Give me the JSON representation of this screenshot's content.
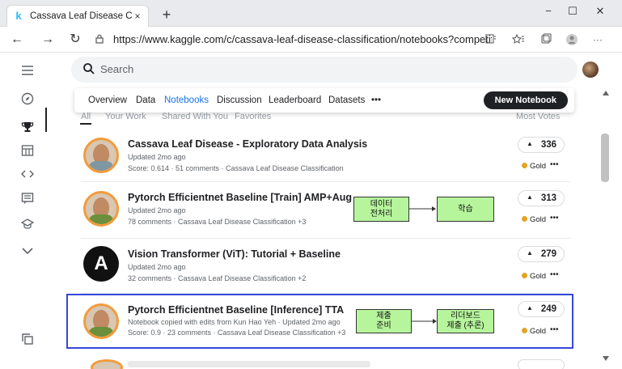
{
  "browser": {
    "tab_title": "Cassava Leaf Disease Classificatio",
    "tab_close": "×",
    "new_tab": "+",
    "url": "https://www.kaggle.com/c/cassava-leaf-disease-classification/notebooks?competitionId...",
    "win_min": "−",
    "win_max": "☐",
    "win_close": "✕",
    "back": "←",
    "forward": "→",
    "refresh": "↻",
    "more": "···"
  },
  "search": {
    "placeholder": "Search"
  },
  "subnav": {
    "items": [
      "Overview",
      "Data",
      "Notebooks",
      "Discussion",
      "Leaderboard",
      "Datasets",
      "•••"
    ],
    "new_notebook": "New Notebook",
    "filters": [
      "All",
      "Your Work",
      "Shared With You",
      "Favorites"
    ],
    "sort": "Most Votes"
  },
  "notebooks": [
    {
      "title": "Cassava Leaf Disease - Exploratory Data Analysis",
      "line1": "Updated 2mo ago",
      "line2": "Score: 0.614 · 51 comments · Cassava Leaf Disease Classification",
      "votes": "336",
      "medal": "Gold"
    },
    {
      "title": "Pytorch Efficientnet Baseline [Train] AMP+Aug",
      "line1": "Updated 2mo ago",
      "line2": "78 comments · Cassava Leaf Disease Classification +3",
      "votes": "313",
      "medal": "Gold"
    },
    {
      "title": "Vision Transformer (ViT): Tutorial + Baseline",
      "line1": "Updated 2mo ago",
      "line2": "32 comments · Cassava Leaf Disease Classification +2",
      "votes": "279",
      "medal": "Gold"
    },
    {
      "title": "Pytorch Efficientnet Baseline [Inference] TTA",
      "line1": "Notebook copied with edits from Kun Hao Yeh · Updated 2mo ago",
      "line2": "Score: 0.9 · 23 comments · Cassava Leaf Disease Classification +3",
      "votes": "249",
      "medal": "Gold"
    }
  ],
  "annotations": {
    "row2_left": "데이터\n전처리",
    "row2_right": "학습",
    "row4_left": "제출\n준비",
    "row4_right": "리더보드\n제출 (추론)"
  },
  "colors": {
    "highlight": "#3548d8",
    "annotation_fill": "#b6f59c",
    "accent": "#1a73e8"
  }
}
